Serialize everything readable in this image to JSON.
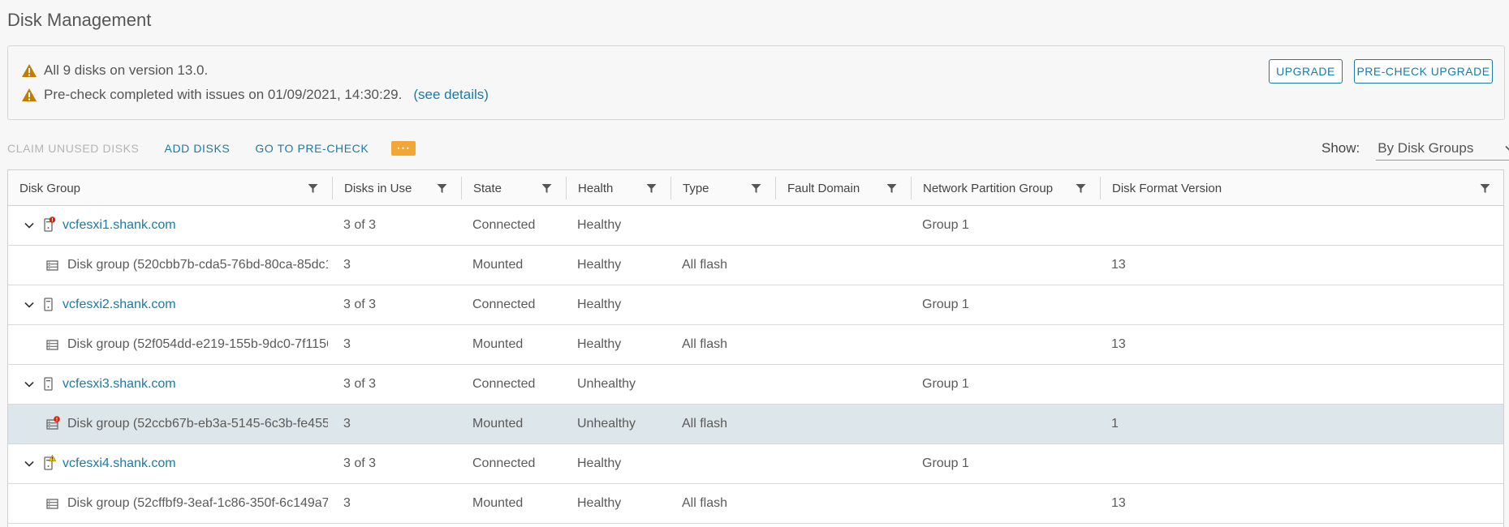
{
  "page_title": "Disk Management",
  "alerts": [
    {
      "text": "All 9 disks on version 13.0.",
      "link": ""
    },
    {
      "text": "Pre-check completed with issues on 01/09/2021, 14:30:29.",
      "link": "(see details)"
    }
  ],
  "alert_buttons": {
    "upgrade": "UPGRADE",
    "precheck": "PRE-CHECK UPGRADE"
  },
  "toolbar": {
    "claim": "CLAIM UNUSED DISKS",
    "add": "ADD DISKS",
    "goto": "GO TO PRE-CHECK",
    "more": "···"
  },
  "show": {
    "label": "Show:",
    "value": "By Disk Groups"
  },
  "columns": [
    "Disk Group",
    "Disks in Use",
    "State",
    "Health",
    "Type",
    "Fault Domain",
    "Network Partition Group",
    "Disk Format Version"
  ],
  "rows": [
    {
      "kind": "host",
      "icon": "host-error-icon",
      "name": "vcfesxi1.shank.com",
      "disks": "3 of 3",
      "state": "Connected",
      "health": "Healthy",
      "type": "",
      "fault": "",
      "npg": "Group 1",
      "dfv": ""
    },
    {
      "kind": "group",
      "icon": "disk-group-icon",
      "name": "Disk group (520cbb7b-cda5-76bd-80ca-85dc1...",
      "disks": "3",
      "state": "Mounted",
      "health": "Healthy",
      "type": "All flash",
      "fault": "",
      "npg": "",
      "dfv": "13"
    },
    {
      "kind": "host",
      "icon": "host-icon",
      "name": "vcfesxi2.shank.com",
      "disks": "3 of 3",
      "state": "Connected",
      "health": "Healthy",
      "type": "",
      "fault": "",
      "npg": "Group 1",
      "dfv": ""
    },
    {
      "kind": "group",
      "icon": "disk-group-icon",
      "name": "Disk group (52f054dd-e219-155b-9dc0-7f1156...",
      "disks": "3",
      "state": "Mounted",
      "health": "Healthy",
      "type": "All flash",
      "fault": "",
      "npg": "",
      "dfv": "13"
    },
    {
      "kind": "host",
      "icon": "host-icon",
      "name": "vcfesxi3.shank.com",
      "disks": "3 of 3",
      "state": "Connected",
      "health": "Unhealthy",
      "type": "",
      "fault": "",
      "npg": "Group 1",
      "dfv": ""
    },
    {
      "kind": "group",
      "icon": "disk-group-error-icon",
      "name": "Disk group (52ccb67b-eb3a-5145-6c3b-fe455f...",
      "disks": "3",
      "state": "Mounted",
      "health": "Unhealthy",
      "type": "All flash",
      "fault": "",
      "npg": "",
      "dfv": "1",
      "selected": true
    },
    {
      "kind": "host",
      "icon": "host-warning-icon",
      "name": "vcfesxi4.shank.com",
      "disks": "3 of 3",
      "state": "Connected",
      "health": "Healthy",
      "type": "",
      "fault": "",
      "npg": "Group 1",
      "dfv": ""
    },
    {
      "kind": "group",
      "icon": "disk-group-icon",
      "name": "Disk group (52cffbf9-3eaf-1c86-350f-6c149a7...",
      "disks": "3",
      "state": "Mounted",
      "health": "Healthy",
      "type": "All flash",
      "fault": "",
      "npg": "",
      "dfv": "13"
    }
  ],
  "colors": {
    "link": "#1b7aa8",
    "warning": "#c27c00",
    "error": "#e12200",
    "more": "#f4a634",
    "selected_row": "#dde6eb"
  }
}
